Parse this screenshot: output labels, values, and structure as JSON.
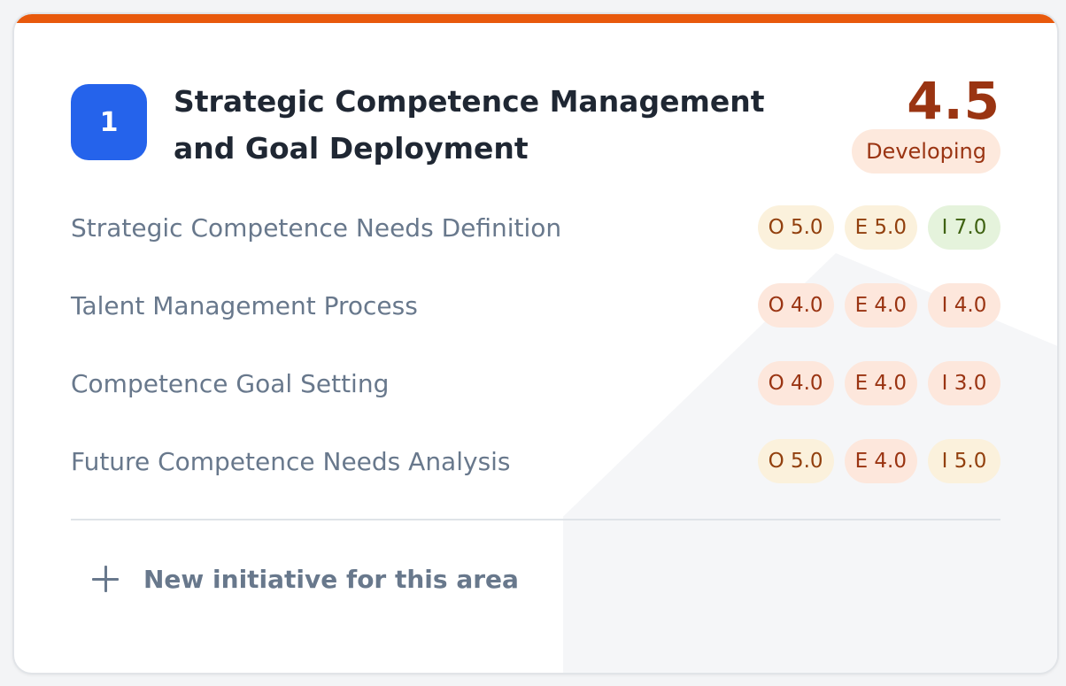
{
  "area": {
    "number": "1",
    "title": "Strategic Competence Management and Goal Deployment",
    "score": "4.5",
    "level": "Developing",
    "accent_color": "#e8590c"
  },
  "rows": [
    {
      "label": "Strategic Competence Needs Definition",
      "chips": [
        {
          "text": "O 5.0",
          "tone": "amber"
        },
        {
          "text": "E 5.0",
          "tone": "amber"
        },
        {
          "text": "I 7.0",
          "tone": "green"
        }
      ]
    },
    {
      "label": "Talent Management Process",
      "chips": [
        {
          "text": "O 4.0",
          "tone": "rust"
        },
        {
          "text": "E 4.0",
          "tone": "rust"
        },
        {
          "text": "I 4.0",
          "tone": "rust"
        }
      ]
    },
    {
      "label": "Competence Goal Setting",
      "chips": [
        {
          "text": "O 4.0",
          "tone": "rust"
        },
        {
          "text": "E 4.0",
          "tone": "rust"
        },
        {
          "text": "I 3.0",
          "tone": "rust"
        }
      ]
    },
    {
      "label": "Future Competence Needs Analysis",
      "chips": [
        {
          "text": "O 5.0",
          "tone": "amber"
        },
        {
          "text": "E 4.0",
          "tone": "rust"
        },
        {
          "text": "I 5.0",
          "tone": "amber"
        }
      ]
    }
  ],
  "actions": {
    "new_initiative_label": "New initiative for this area",
    "new_initiative_icon": "plus-icon"
  }
}
